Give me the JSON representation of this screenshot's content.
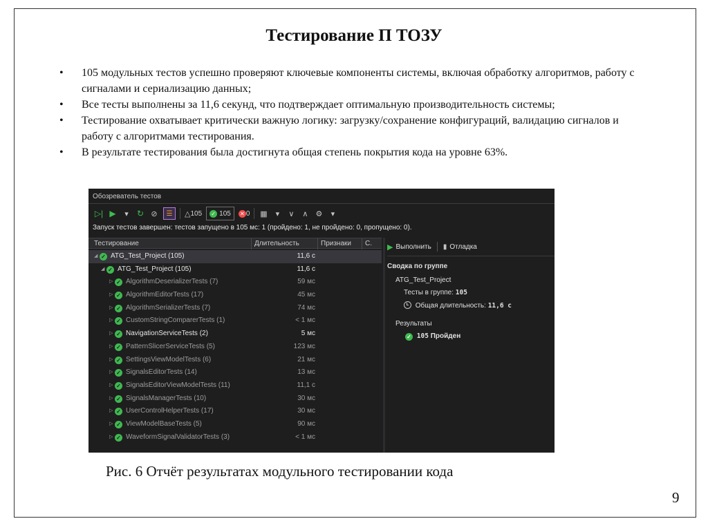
{
  "slide": {
    "title": "Тестирование П ТОЗУ",
    "bullets": [
      "105 модульных тестов успешно проверяют ключевые компоненты системы, включая обработку алгоритмов, работу с сигналами и сериализацию данных;",
      "Все тесты выполнены за 11,6 секунд, что подтверждает оптимальную производительность системы;",
      "Тестирование охватывает критически важную логику: загрузку/сохранение конфигураций, валидацию сигналов и работу с алгоритмами тестирования.",
      "В результате тестирования была достигнута общая степень покрытия кода на уровне 63%."
    ],
    "caption": "Рис. 6 Отчёт результатах модульного тестировании кода",
    "page_number": "9"
  },
  "test_explorer": {
    "window_title": "Обозреватель тестов",
    "toolbar": {
      "total_count": "105",
      "passed_count": "105",
      "failed_count": "0"
    },
    "status": "Запуск тестов завершен: тестов запущено в 105 мс: 1 (пройдено: 1, не пройдено: 0, пропущено: 0).",
    "columns": {
      "name": "Тестирование",
      "duration": "Длительность",
      "traits": "Признаки",
      "extra": "С."
    },
    "tree": [
      {
        "name": "ATG_Test_Project (105)",
        "duration": "11,6 с",
        "level": 0,
        "bright": true,
        "selected": true
      },
      {
        "name": "ATG_Test_Project (105)",
        "duration": "11,6 с",
        "level": 1,
        "bright": true
      },
      {
        "name": "AlgorithmDeserializerTests (7)",
        "duration": "59 мс",
        "level": 2
      },
      {
        "name": "AlgorithmEditorTests (17)",
        "duration": "45 мс",
        "level": 2
      },
      {
        "name": "AlgorithmSerializerTests (7)",
        "duration": "74 мс",
        "level": 2
      },
      {
        "name": "CustomStringComparerTests (1)",
        "duration": "< 1 мс",
        "level": 2
      },
      {
        "name": "NavigationServiceTests (2)",
        "duration": "5 мс",
        "level": 2,
        "bright": true
      },
      {
        "name": "PatternSlicerServiceTests (5)",
        "duration": "123 мс",
        "level": 2
      },
      {
        "name": "SettingsViewModelTests (6)",
        "duration": "21 мс",
        "level": 2
      },
      {
        "name": "SignalsEditorTests (14)",
        "duration": "13 мс",
        "level": 2
      },
      {
        "name": "SignalsEditorViewModelTests (11)",
        "duration": "11,1 с",
        "level": 2
      },
      {
        "name": "SignalsManagerTests (10)",
        "duration": "30 мс",
        "level": 2
      },
      {
        "name": "UserControlHelperTests (17)",
        "duration": "30 мс",
        "level": 2
      },
      {
        "name": "ViewModelBaseTests (5)",
        "duration": "90 мс",
        "level": 2
      },
      {
        "name": "WaveformSignalValidatorTests (3)",
        "duration": "< 1 мс",
        "level": 2
      }
    ],
    "details": {
      "run_label": "Выполнить",
      "debug_label": "Отладка",
      "summary_heading": "Сводка по группе",
      "group_name": "ATG_Test_Project",
      "tests_in_group_label": "Тесты в группе:",
      "tests_in_group_value": "105",
      "total_duration_label": "Общая длительность:",
      "total_duration_value": "11,6 с",
      "results_heading": "Результаты",
      "passed_count": "105",
      "passed_label": "Пройден"
    },
    "colors": {
      "background": "#1e1e1e",
      "pass": "#3fb950",
      "fail": "#f14c4c"
    }
  }
}
